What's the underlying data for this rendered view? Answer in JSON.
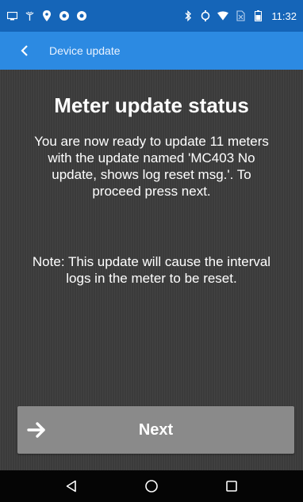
{
  "status_bar": {
    "time": "11:32",
    "left_icons": [
      "screen-icon",
      "signal-icon",
      "location-pin-icon",
      "app-icon-1",
      "app-icon-2"
    ],
    "right_icons": [
      "bluetooth-icon",
      "sync-icon",
      "wifi-icon",
      "no-sim-icon",
      "battery-icon"
    ]
  },
  "app_bar": {
    "title": "Device update",
    "color": "#2c8ae2"
  },
  "main": {
    "title": "Meter update status",
    "message": "You are now ready to update 11 meters with the update named 'MC403 No update, shows log reset msg.'. To proceed press next.",
    "note": "Note: This update will cause the interval logs in the meter to be reset."
  },
  "next_button": {
    "label": "Next"
  },
  "nav_bar": {
    "buttons": [
      "back-nav-icon",
      "home-nav-icon",
      "recents-nav-icon"
    ]
  }
}
